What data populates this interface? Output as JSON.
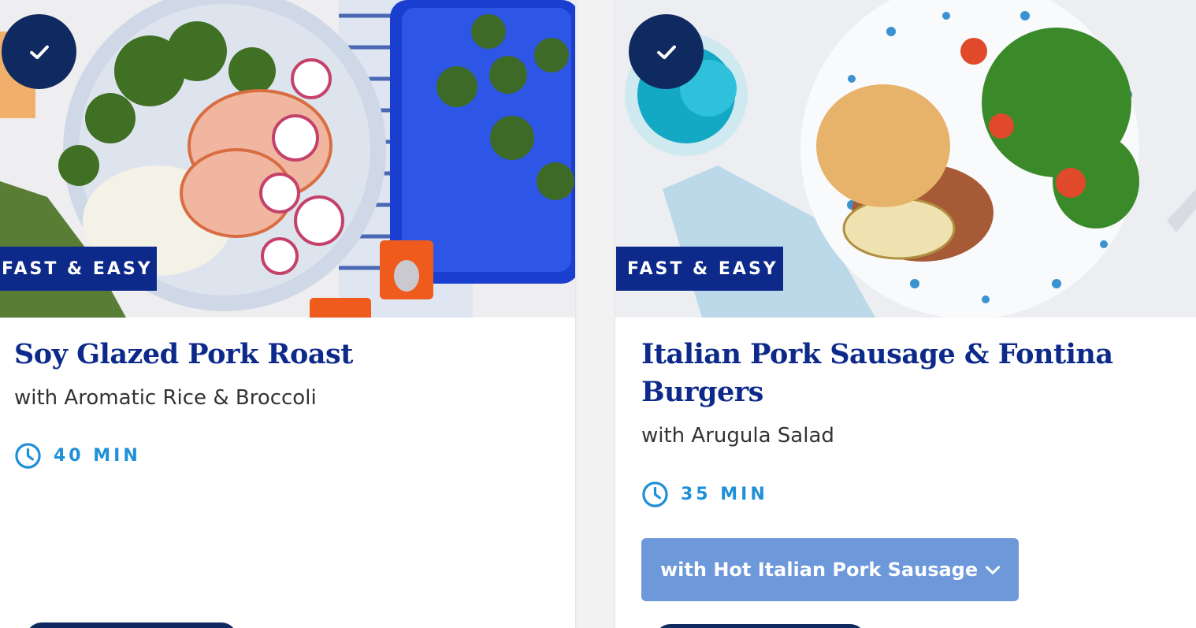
{
  "cards": [
    {
      "selected": true,
      "badge": "FAST & EASY",
      "title": "Soy Glazed Pork Roast",
      "subtitle": "with Aromatic Rice & Broccoli",
      "time": "40 MIN"
    },
    {
      "selected": true,
      "badge": "FAST & EASY",
      "title_line1": "Italian Pork Sausage & Fontina",
      "title_line2": "Burgers",
      "subtitle": "with Arugula Salad",
      "time": "35 MIN",
      "variant_select": "with Hot Italian Pork Sausage"
    }
  ],
  "icons": {
    "check": "check-icon",
    "clock": "clock-icon",
    "chevron": "chevron-down-icon"
  },
  "colors": {
    "title": "#0d2a8a",
    "badge_bg": "#0d2a8a",
    "check_bg": "#0f2a60",
    "time": "#1e8fd8",
    "variant_bg": "#6d98da"
  }
}
